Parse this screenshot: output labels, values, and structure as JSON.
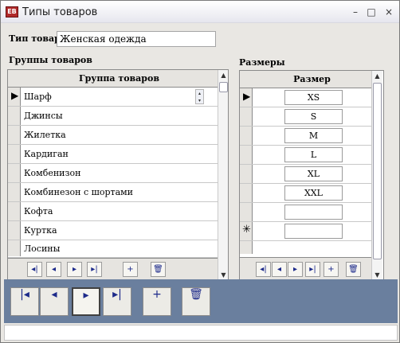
{
  "window": {
    "title": "Типы товаров",
    "icon_text": "EB",
    "minimize_glyph": "–",
    "maximize_glyph": "□",
    "close_glyph": "×"
  },
  "form": {
    "type_label": "Тип товара",
    "type_value": "Женская одежда",
    "groups_label": "Группы товаров",
    "sizes_label": "Размеры"
  },
  "groups_grid": {
    "header": "Группа товаров",
    "rows": [
      "Шарф",
      "Джинсы",
      "Жилетка",
      "Кардиган",
      "Комбенизон",
      "Комбинезон с шортами",
      "Кофта",
      "Куртка",
      "Лосины"
    ],
    "nav": {
      "first": "◂|",
      "prev": "◂",
      "next": "▸",
      "last": "▸|",
      "add": "+",
      "delete": "🗑"
    }
  },
  "sizes_grid": {
    "header": "Размер",
    "rows": [
      "XS",
      "S",
      "M",
      "L",
      "XL",
      "XXL",
      ""
    ],
    "new_row_marker": "✳",
    "nav": {
      "first": "◂|",
      "prev": "◂",
      "next": "▸",
      "last": "▸|",
      "add": "+",
      "delete": "🗑"
    }
  },
  "bottom_nav": {
    "first": "|◂",
    "prev": "◂",
    "next": "▸",
    "last": "▸|",
    "add": "+",
    "delete": "🗑"
  },
  "colors": {
    "accent": "#1d2a8a",
    "panel": "#6a7f9e"
  }
}
